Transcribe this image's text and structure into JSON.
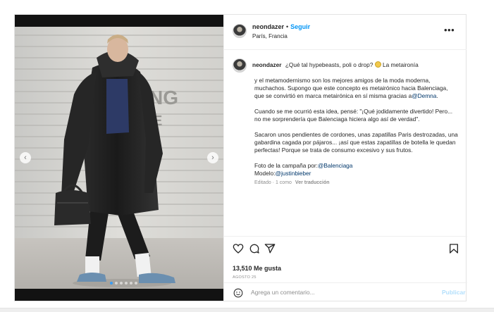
{
  "post": {
    "username": "neondazer",
    "separator": "•",
    "follow_label": "Seguir",
    "location": "París, Francia",
    "more_label": "•••"
  },
  "caption": {
    "username": "neondazer",
    "first_line": "¿Qué tal hypebeasts, poli o drop?",
    "first_line_tail": "La metaironía",
    "paragraph1": "y el metamodernismo son los mejores amigos de la moda moderna, muchachos. Supongo que este concepto es metairónico hacia Balenciaga, que se convirtió en marca metairónica en sí misma gracias a",
    "paragraph1_mention": "@Demna",
    "paragraph1_end": ".",
    "paragraph2": "Cuando se me ocurrió esta idea, pensé: \"¡Qué jodidamente divertido! Pero... no me sorprendería que Balenciaga hiciera algo así de verdad\".",
    "paragraph3": "Sacaron unos pendientes de cordones, unas zapatillas Paris destrozadas, una gabardina cagada por pájaros... ¡así que estas zapatillas de botella le quedan perfectas! Porque se trata de consumo excesivo y sus frutos.",
    "credit_photo_prefix": "Foto de la campaña por:",
    "credit_photo_mention": "@Balenciaga",
    "credit_model_prefix": "Modelo:",
    "credit_model_mention": "@justinbieber",
    "meta_edited": "Editado · 1 como",
    "meta_translate": "Ver traducción"
  },
  "engagement": {
    "likes": "13,510 Me gusta",
    "date": "AGOSTO 25"
  },
  "comment": {
    "placeholder": "Agrega un comentario...",
    "publish_label": "Publicar"
  },
  "media": {
    "wall_text_1": "NG",
    "wall_text_2": "E",
    "slide_count": 6,
    "active_slide": 1
  },
  "colors": {
    "accent": "#0095f6",
    "publish_disabled": "#b2dffc",
    "text": "#262626",
    "muted": "#8e8e8e",
    "mention": "#00376b"
  }
}
